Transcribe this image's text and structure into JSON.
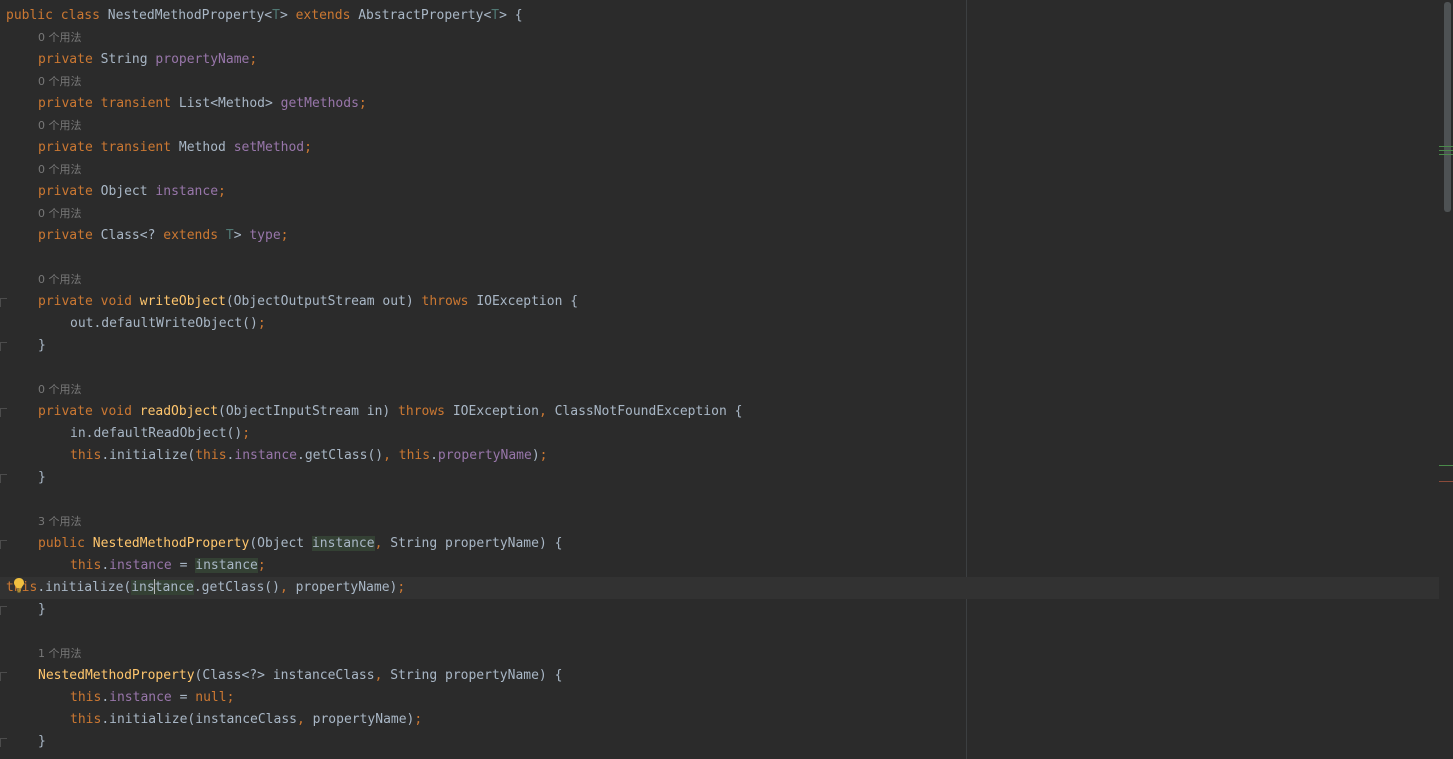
{
  "editor": {
    "language": "Java",
    "theme": "Darcula",
    "colors": {
      "background": "#2b2b2b",
      "keyword": "#cc7832",
      "field": "#9876aa",
      "method_decl": "#ffc66d",
      "type_param": "#507874",
      "plain": "#a9b7c6",
      "hint": "#787878",
      "current_line": "#323232",
      "usage_highlight": "#344134"
    },
    "lines": [
      {
        "kind": "code",
        "indent": 0,
        "tokens": [
          {
            "t": "public class ",
            "c": "kw"
          },
          {
            "t": "NestedMethodProperty",
            "c": "pl"
          },
          {
            "t": "<",
            "c": "pl"
          },
          {
            "t": "T",
            "c": "tp"
          },
          {
            "t": "> ",
            "c": "pl"
          },
          {
            "t": "extends ",
            "c": "kw"
          },
          {
            "t": "AbstractProperty",
            "c": "pl"
          },
          {
            "t": "<",
            "c": "pl"
          },
          {
            "t": "T",
            "c": "tp"
          },
          {
            "t": "> {",
            "c": "pl"
          }
        ]
      },
      {
        "kind": "hint",
        "indent": 1,
        "text": "0 个用法"
      },
      {
        "kind": "code",
        "indent": 1,
        "tokens": [
          {
            "t": "private ",
            "c": "kw"
          },
          {
            "t": "String ",
            "c": "pl"
          },
          {
            "t": "propertyName",
            "c": "fld"
          },
          {
            "t": ";",
            "c": "sem"
          }
        ]
      },
      {
        "kind": "hint",
        "indent": 1,
        "text": "0 个用法"
      },
      {
        "kind": "code",
        "indent": 1,
        "tokens": [
          {
            "t": "private transient ",
            "c": "kw"
          },
          {
            "t": "List<Method> ",
            "c": "pl"
          },
          {
            "t": "getMethods",
            "c": "fld"
          },
          {
            "t": ";",
            "c": "sem"
          }
        ]
      },
      {
        "kind": "hint",
        "indent": 1,
        "text": "0 个用法"
      },
      {
        "kind": "code",
        "indent": 1,
        "tokens": [
          {
            "t": "private transient ",
            "c": "kw"
          },
          {
            "t": "Method ",
            "c": "pl"
          },
          {
            "t": "setMethod",
            "c": "fld"
          },
          {
            "t": ";",
            "c": "sem"
          }
        ]
      },
      {
        "kind": "hint",
        "indent": 1,
        "text": "0 个用法"
      },
      {
        "kind": "code",
        "indent": 1,
        "tokens": [
          {
            "t": "private ",
            "c": "kw"
          },
          {
            "t": "Object ",
            "c": "pl"
          },
          {
            "t": "instance",
            "c": "fld"
          },
          {
            "t": ";",
            "c": "sem"
          }
        ]
      },
      {
        "kind": "hint",
        "indent": 1,
        "text": "0 个用法"
      },
      {
        "kind": "code",
        "indent": 1,
        "tokens": [
          {
            "t": "private ",
            "c": "kw"
          },
          {
            "t": "Class<? ",
            "c": "pl"
          },
          {
            "t": "extends ",
            "c": "kw"
          },
          {
            "t": "T",
            "c": "tp"
          },
          {
            "t": "> ",
            "c": "pl"
          },
          {
            "t": "type",
            "c": "fld"
          },
          {
            "t": ";",
            "c": "sem"
          }
        ]
      },
      {
        "kind": "blank"
      },
      {
        "kind": "hint",
        "indent": 1,
        "text": "0 个用法"
      },
      {
        "kind": "code",
        "indent": 1,
        "fold": true,
        "tokens": [
          {
            "t": "private void ",
            "c": "kw"
          },
          {
            "t": "writeObject",
            "c": "meth"
          },
          {
            "t": "(ObjectOutputStream out) ",
            "c": "pl"
          },
          {
            "t": "throws ",
            "c": "kw"
          },
          {
            "t": "IOException {",
            "c": "pl"
          }
        ]
      },
      {
        "kind": "code",
        "indent": 2,
        "tokens": [
          {
            "t": "out.defaultWriteObject()",
            "c": "pl"
          },
          {
            "t": ";",
            "c": "sem"
          }
        ]
      },
      {
        "kind": "code",
        "indent": 1,
        "fold": true,
        "tokens": [
          {
            "t": "}",
            "c": "pl"
          }
        ]
      },
      {
        "kind": "blank"
      },
      {
        "kind": "hint",
        "indent": 1,
        "text": "0 个用法"
      },
      {
        "kind": "code",
        "indent": 1,
        "fold": true,
        "tokens": [
          {
            "t": "private void ",
            "c": "kw"
          },
          {
            "t": "readObject",
            "c": "meth"
          },
          {
            "t": "(ObjectInputStream in) ",
            "c": "pl"
          },
          {
            "t": "throws ",
            "c": "kw"
          },
          {
            "t": "IOException",
            "c": "pl"
          },
          {
            "t": ", ",
            "c": "sem"
          },
          {
            "t": "ClassNotFoundException {",
            "c": "pl"
          }
        ]
      },
      {
        "kind": "code",
        "indent": 2,
        "tokens": [
          {
            "t": "in.defaultReadObject()",
            "c": "pl"
          },
          {
            "t": ";",
            "c": "sem"
          }
        ]
      },
      {
        "kind": "code",
        "indent": 2,
        "tokens": [
          {
            "t": "this",
            "c": "kw"
          },
          {
            "t": ".initialize(",
            "c": "pl"
          },
          {
            "t": "this",
            "c": "kw"
          },
          {
            "t": ".",
            "c": "pl"
          },
          {
            "t": "instance",
            "c": "fld"
          },
          {
            "t": ".getClass()",
            "c": "pl"
          },
          {
            "t": ", ",
            "c": "sem"
          },
          {
            "t": "this",
            "c": "kw"
          },
          {
            "t": ".",
            "c": "pl"
          },
          {
            "t": "propertyName",
            "c": "fld"
          },
          {
            "t": ")",
            "c": "pl"
          },
          {
            "t": ";",
            "c": "sem"
          }
        ]
      },
      {
        "kind": "code",
        "indent": 1,
        "fold": true,
        "tokens": [
          {
            "t": "}",
            "c": "pl"
          }
        ]
      },
      {
        "kind": "blank"
      },
      {
        "kind": "hint",
        "indent": 1,
        "text": "3 个用法"
      },
      {
        "kind": "code",
        "indent": 1,
        "fold": true,
        "tokens": [
          {
            "t": "public ",
            "c": "kw"
          },
          {
            "t": "NestedMethodProperty",
            "c": "meth"
          },
          {
            "t": "(Object ",
            "c": "pl"
          },
          {
            "t": "instance",
            "c": "pl",
            "hl": true
          },
          {
            "t": ", ",
            "c": "sem"
          },
          {
            "t": "String propertyName) {",
            "c": "pl"
          }
        ]
      },
      {
        "kind": "code",
        "indent": 2,
        "tokens": [
          {
            "t": "this",
            "c": "kw"
          },
          {
            "t": ".",
            "c": "pl"
          },
          {
            "t": "instance",
            "c": "fld"
          },
          {
            "t": " = ",
            "c": "pl"
          },
          {
            "t": "instance",
            "c": "pl",
            "hl": true
          },
          {
            "t": ";",
            "c": "sem"
          }
        ]
      },
      {
        "kind": "code",
        "indent": 2,
        "current": true,
        "bulb": true,
        "tokens": [
          {
            "t": "this",
            "c": "kw"
          },
          {
            "t": ".initialize(",
            "c": "pl"
          },
          {
            "t": "ins",
            "c": "pl",
            "hl": true
          },
          {
            "caret": true
          },
          {
            "t": "tance",
            "c": "pl",
            "hl": true
          },
          {
            "t": ".getClass()",
            "c": "pl"
          },
          {
            "t": ", ",
            "c": "sem"
          },
          {
            "t": "propertyName)",
            "c": "pl"
          },
          {
            "t": ";",
            "c": "sem"
          }
        ]
      },
      {
        "kind": "code",
        "indent": 1,
        "fold": true,
        "tokens": [
          {
            "t": "}",
            "c": "pl"
          }
        ]
      },
      {
        "kind": "blank"
      },
      {
        "kind": "hint",
        "indent": 1,
        "text": "1 个用法"
      },
      {
        "kind": "code",
        "indent": 1,
        "fold": true,
        "tokens": [
          {
            "t": "NestedMethodProperty",
            "c": "meth"
          },
          {
            "t": "(Class<?> instanceClass",
            "c": "pl"
          },
          {
            "t": ", ",
            "c": "sem"
          },
          {
            "t": "String propertyName) {",
            "c": "pl"
          }
        ]
      },
      {
        "kind": "code",
        "indent": 2,
        "tokens": [
          {
            "t": "this",
            "c": "kw"
          },
          {
            "t": ".",
            "c": "pl"
          },
          {
            "t": "instance",
            "c": "fld"
          },
          {
            "t": " = ",
            "c": "pl"
          },
          {
            "t": "null",
            "c": "kw"
          },
          {
            "t": ";",
            "c": "sem"
          }
        ]
      },
      {
        "kind": "code",
        "indent": 2,
        "tokens": [
          {
            "t": "this",
            "c": "kw"
          },
          {
            "t": ".initialize(instanceClass",
            "c": "pl"
          },
          {
            "t": ", ",
            "c": "sem"
          },
          {
            "t": "propertyName)",
            "c": "pl"
          },
          {
            "t": ";",
            "c": "sem"
          }
        ]
      },
      {
        "kind": "code",
        "indent": 1,
        "fold": true,
        "tokens": [
          {
            "t": "}",
            "c": "pl"
          }
        ]
      }
    ]
  }
}
